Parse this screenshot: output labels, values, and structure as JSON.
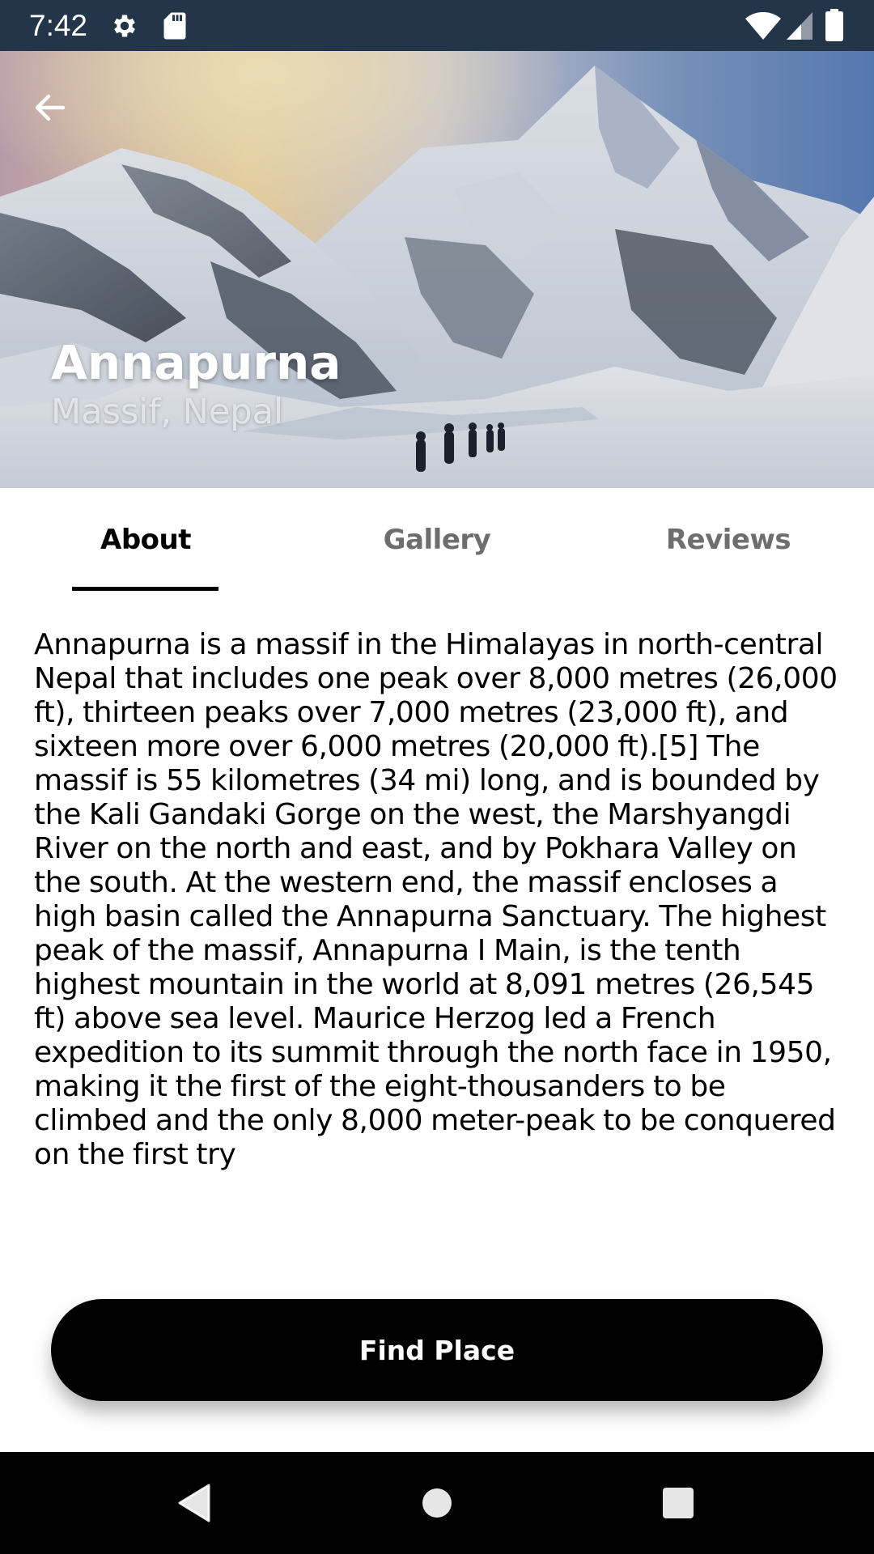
{
  "status_bar": {
    "time": "7:42",
    "icons": [
      "gear-icon",
      "sd-card-icon",
      "wifi-icon",
      "cell-signal-icon",
      "battery-icon"
    ]
  },
  "header": {
    "back_icon": "arrow-left-icon",
    "title": "Annapurna",
    "subtitle": "Massif, Nepal"
  },
  "tabs": [
    {
      "label": "About",
      "active": true
    },
    {
      "label": "Gallery",
      "active": false
    },
    {
      "label": "Reviews",
      "active": false
    }
  ],
  "about": {
    "text": "Annapurna is a massif in the Himalayas in north-central Nepal that includes one peak over 8,000 metres (26,000 ft), thirteen peaks over 7,000 metres (23,000 ft), and sixteen more over 6,000 metres (20,000 ft).[5] The massif is 55 kilometres (34 mi) long, and is bounded by the Kali Gandaki Gorge on the west, the Marshyangdi River on the north and east, and by Pokhara Valley on the south. At the western end, the massif encloses a high basin called the Annapurna Sanctuary. The highest peak of the massif, Annapurna I Main, is the tenth highest mountain in the world at 8,091 metres (26,545 ft) above sea level. Maurice Herzog led a French expedition to its summit through the north face in 1950, making it the first of the eight-thousanders to be climbed and the only 8,000 meter-peak to be conquered on the first try"
  },
  "actions": {
    "find_place_label": "Find Place"
  },
  "nav_bar": {
    "icons": [
      "nav-back-icon",
      "nav-home-icon",
      "nav-recents-icon"
    ]
  },
  "colors": {
    "status_bar": "#24354a",
    "primary": "#000000",
    "tab_inactive": "#6e6e6e",
    "background": "#ffffff"
  }
}
